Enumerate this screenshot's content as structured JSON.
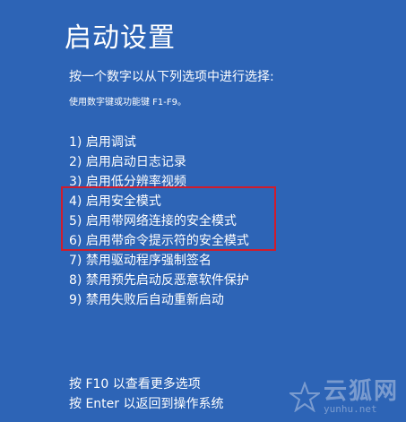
{
  "title": "启动设置",
  "subtitle": "按一个数字以从下列选项中进行选择:",
  "hint": "使用数字键或功能键 F1-F9。",
  "options": [
    "1) 启用调试",
    "2) 启用启动日志记录",
    "3) 启用低分辨率视频",
    "4) 启用安全模式",
    "5) 启用带网络连接的安全模式",
    "6) 启用带命令提示符的安全模式",
    "7) 禁用驱动程序强制签名",
    "8) 禁用预先启动反恶意软件保护",
    "9) 禁用失败后自动重新启动"
  ],
  "footer": {
    "more_options": "按 F10 以查看更多选项",
    "return_os": "按 Enter 以返回到操作系统"
  },
  "watermark": {
    "name": "云狐网",
    "url": "yunhu.net"
  },
  "colors": {
    "background": "#2d64b6",
    "text": "#ffffff",
    "highlight_border": "#d01c2c"
  },
  "icons": {
    "watermark": "star-icon"
  }
}
